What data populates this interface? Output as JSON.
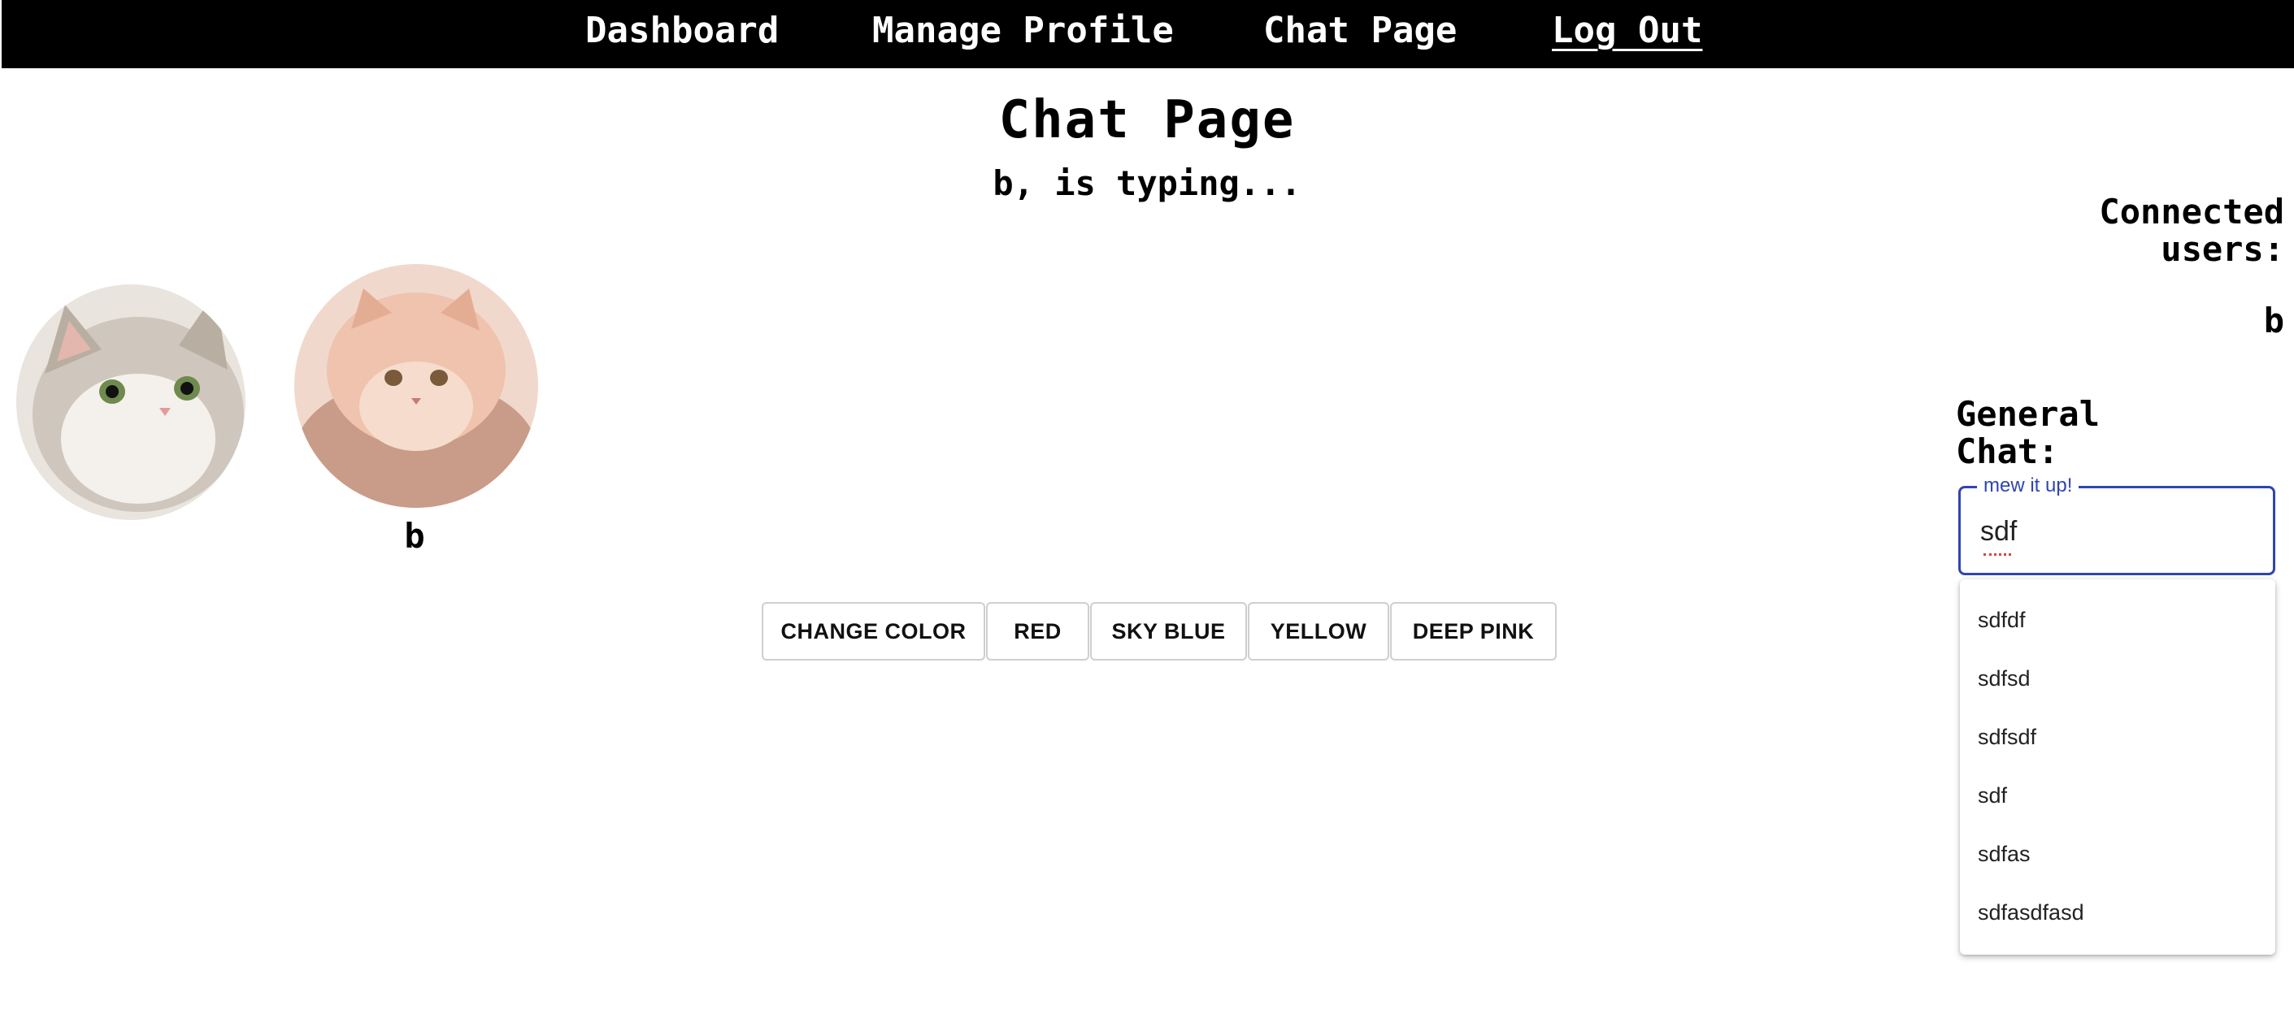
{
  "nav": {
    "items": [
      {
        "label": "Dashboard"
      },
      {
        "label": "Manage Profile"
      },
      {
        "label": "Chat Page"
      },
      {
        "label": "Log Out"
      }
    ]
  },
  "page": {
    "title": "Chat Page",
    "typing_status": "b, is typing..."
  },
  "avatars": [
    {
      "icon": "grey-cat-avatar",
      "name": ""
    },
    {
      "icon": "orange-cat-avatar",
      "name": "b"
    }
  ],
  "color_buttons": [
    {
      "label": "CHANGE COLOR"
    },
    {
      "label": "RED"
    },
    {
      "label": "SKY BLUE"
    },
    {
      "label": "YELLOW"
    },
    {
      "label": "DEEP PINK"
    }
  ],
  "sidebar": {
    "connected_heading": "Connected users:",
    "connected_users": [
      "b"
    ],
    "chat_heading": "General Chat:"
  },
  "chat_input": {
    "label": "mew it up!",
    "value": "sdf",
    "accent": "#2f45b0"
  },
  "autocomplete": {
    "options": [
      "sdfdf",
      "sdfsd",
      "sdfsdf",
      "sdf",
      "sdfas",
      "sdfasdfasd"
    ]
  }
}
